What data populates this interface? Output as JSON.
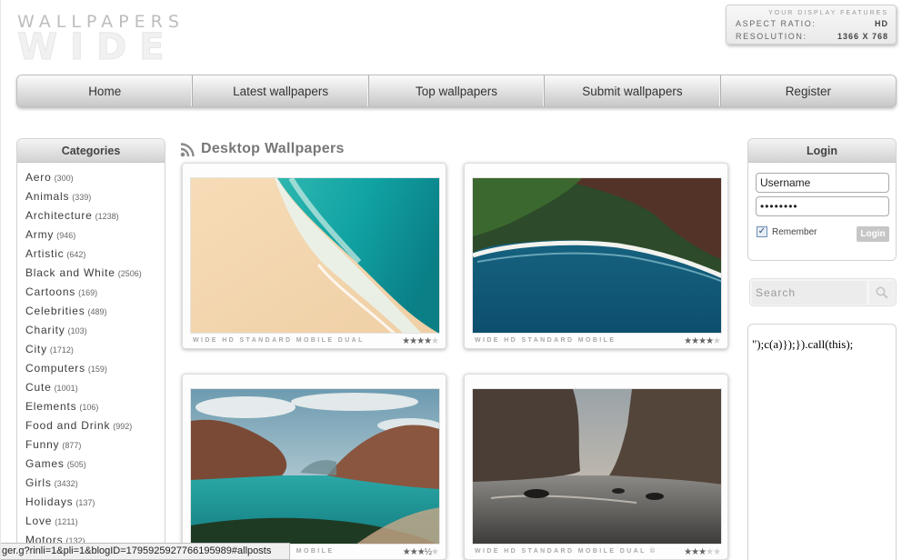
{
  "logo": {
    "top": "WALLPAPERS",
    "bottom": "WIDE"
  },
  "display_features": {
    "title": "YOUR DISPLAY FEATURES",
    "aspect_label": "ASPECT RATIO:",
    "aspect_value": "HD",
    "resolution_label": "RESOLUTION:",
    "resolution_value": "1366 X 768"
  },
  "nav": {
    "items": [
      {
        "label": "Home"
      },
      {
        "label": "Latest wallpapers"
      },
      {
        "label": "Top wallpapers"
      },
      {
        "label": "Submit wallpapers"
      },
      {
        "label": "Register"
      }
    ]
  },
  "categories": {
    "title": "Categories",
    "items": [
      {
        "label": "Aero",
        "count": "(300)"
      },
      {
        "label": "Animals",
        "count": "(339)"
      },
      {
        "label": "Architecture",
        "count": "(1238)"
      },
      {
        "label": "Army",
        "count": "(946)"
      },
      {
        "label": "Artistic",
        "count": "(642)"
      },
      {
        "label": "Black and White",
        "count": "(2506)"
      },
      {
        "label": "Cartoons",
        "count": "(169)"
      },
      {
        "label": "Celebrities",
        "count": "(489)"
      },
      {
        "label": "Charity",
        "count": "(103)"
      },
      {
        "label": "City",
        "count": "(1712)"
      },
      {
        "label": "Computers",
        "count": "(159)"
      },
      {
        "label": "Cute",
        "count": "(1001)"
      },
      {
        "label": "Elements",
        "count": "(106)"
      },
      {
        "label": "Food and Drink",
        "count": "(992)"
      },
      {
        "label": "Funny",
        "count": "(877)"
      },
      {
        "label": "Games",
        "count": "(505)"
      },
      {
        "label": "Girls",
        "count": "(3432)"
      },
      {
        "label": "Holidays",
        "count": "(137)"
      },
      {
        "label": "Love",
        "count": "(1211)"
      },
      {
        "label": "Motors",
        "count": "(132)"
      }
    ]
  },
  "main": {
    "title": "Desktop Wallpapers"
  },
  "wallpapers": [
    {
      "meta": "WIDE HD STANDARD MOBILE DUAL",
      "rating": 4,
      "icon": "beach-aerial"
    },
    {
      "meta": "WIDE HD STANDARD MOBILE",
      "rating": 4,
      "icon": "coast-cliffs"
    },
    {
      "meta": "WIDE HD STANDARD MOBILE",
      "rating": 3.5,
      "icon": "fjord"
    },
    {
      "meta": "WIDE HD STANDARD MOBILE DUAL ©",
      "rating": 3,
      "icon": "sea-rocks"
    }
  ],
  "login": {
    "title": "Login",
    "username": "Username",
    "password": "••••••••",
    "remember_label": "Remember",
    "remember_checked": true,
    "button": "Login"
  },
  "search": {
    "placeholder": "Search"
  },
  "adbox": {
    "text": "\");c(a)});}).call(this);"
  },
  "statusbar": {
    "text": "ger.g?rinli=1&pli=1&blogID=1795925927766195989#allposts"
  },
  "colors": {
    "accent_gray": "#777777",
    "nav_text": "#333333"
  }
}
